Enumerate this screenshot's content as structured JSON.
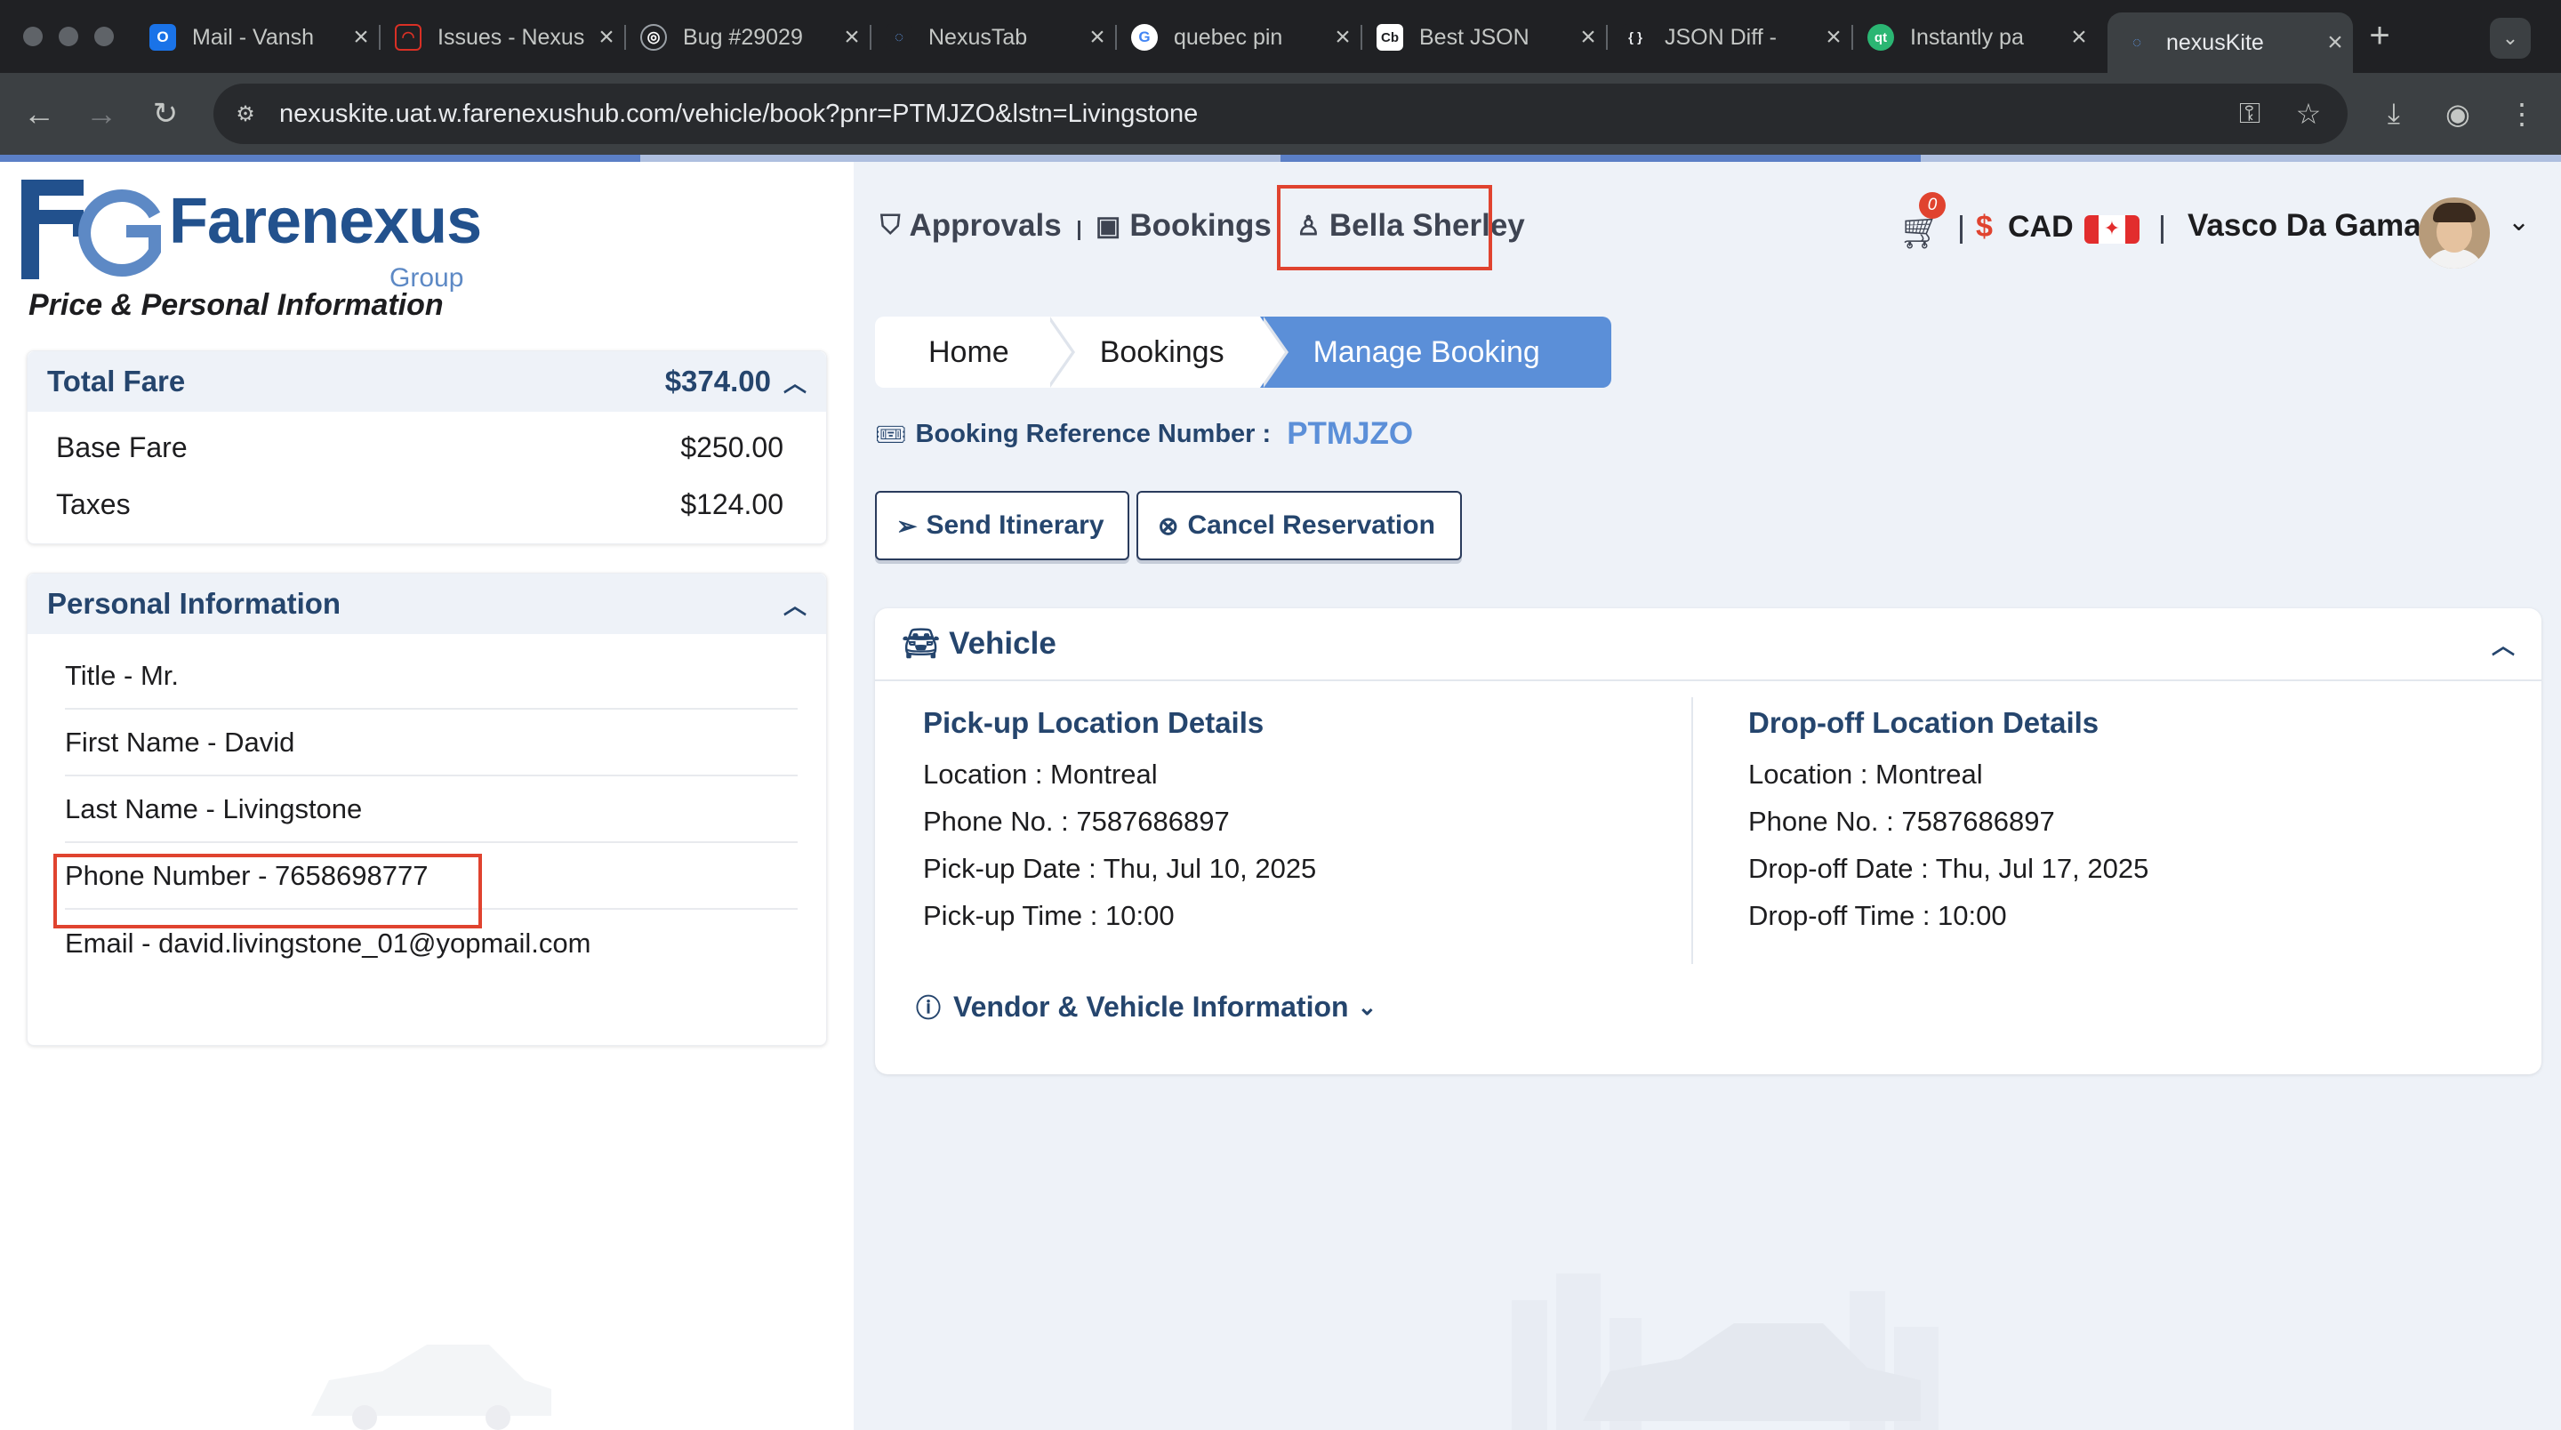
{
  "browser": {
    "tabs": [
      {
        "title": "Mail - Vansh",
        "favicon": "outlook-icon",
        "color": "#1a73e8",
        "glyph": "O"
      },
      {
        "title": "Issues - Nexus",
        "favicon": "issues-icon",
        "color": "#d93025",
        "glyph": "◠"
      },
      {
        "title": "Bug #29029",
        "favicon": "bug-icon",
        "color": "#5f6368",
        "glyph": "◎"
      },
      {
        "title": "NexusTab",
        "favicon": "nexus-icon",
        "color": "#3c4043",
        "glyph": "◌"
      },
      {
        "title": "quebec pin",
        "favicon": "google-icon",
        "color": "#ffffff",
        "glyph": "G"
      },
      {
        "title": "Best JSON",
        "favicon": "codebeautify-icon",
        "color": "#ffffff",
        "glyph": "Cb"
      },
      {
        "title": "JSON Diff -",
        "favicon": "json-icon",
        "color": "#202124",
        "glyph": "{ }"
      },
      {
        "title": "Instantly pa",
        "favicon": "qt-icon",
        "color": "#2bb673",
        "glyph": "qt"
      },
      {
        "title": "nexusKite",
        "favicon": "nexuskite-icon",
        "color": "#3c4043",
        "glyph": "◌"
      }
    ],
    "url": "nexuskite.uat.w.farenexushub.com/vehicle/book?pnr=PTMJZO&lstn=Livingstone"
  },
  "logo": {
    "brand": "Farenexus",
    "group": "Group",
    "mark": "FG"
  },
  "left": {
    "title": "Price & Personal Information",
    "total_fare_label": "Total Fare",
    "total_fare_value": "$374.00",
    "fare_items": [
      {
        "label": "Base Fare",
        "value": "$250.00"
      },
      {
        "label": "Taxes",
        "value": "$124.00"
      }
    ],
    "personal_title": "Personal Information",
    "personal_items": [
      "Title - Mr.",
      "First Name - David",
      "Last Name - Livingstone",
      "Phone Number - 7658698777",
      "Email - david.livingstone_01@yopmail.com"
    ]
  },
  "topnav": {
    "approvals": "Approvals",
    "bookings": "Bookings",
    "traveler": "Bella Sherley",
    "cart_count": "0",
    "currency_symbol": "$",
    "currency": "CAD",
    "user_name": "Vasco Da Gama"
  },
  "breadcrumb": [
    "Home",
    "Bookings",
    "Manage Booking"
  ],
  "booking_ref": {
    "label": "Booking Reference Number :",
    "value": "PTMJZO"
  },
  "actions": {
    "send": "Send Itinerary",
    "cancel": "Cancel Reservation"
  },
  "vehicle": {
    "title": "Vehicle",
    "pickup": {
      "heading": "Pick-up Location Details",
      "lines": [
        "Location : Montreal",
        "Phone No. : 7587686897",
        "Pick-up Date : Thu, Jul 10, 2025",
        "Pick-up Time : 10:00"
      ]
    },
    "dropoff": {
      "heading": "Drop-off Location Details",
      "lines": [
        "Location : Montreal",
        "Phone No. : 7587686897",
        "Drop-off Date : Thu, Jul 17, 2025",
        "Drop-off Time : 10:00"
      ]
    },
    "vendor_link": "Vendor & Vehicle Information"
  },
  "colors": {
    "accent": "#5b8fd8",
    "brand": "#22518d",
    "highlight": "#e0432f",
    "heading": "#25456d"
  }
}
